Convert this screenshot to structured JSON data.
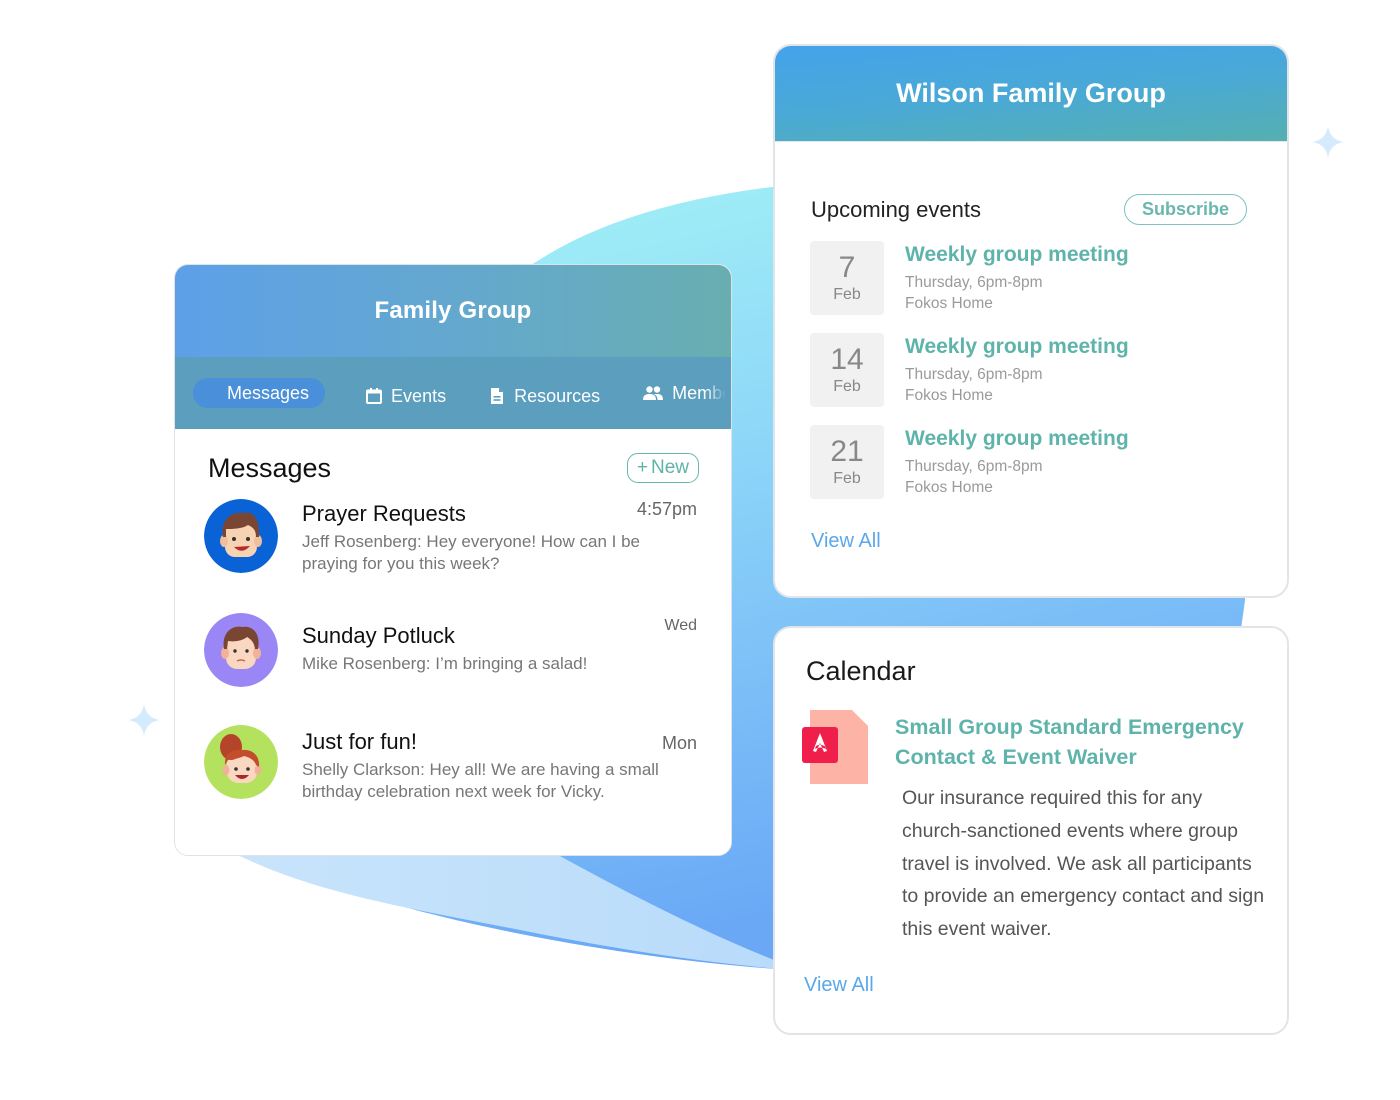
{
  "family_group": {
    "title": "Family Group",
    "tabs": [
      {
        "label": "Messages",
        "icon": "chat",
        "active": true
      },
      {
        "label": "Events",
        "icon": "calendar-icon",
        "active": false
      },
      {
        "label": "Resources",
        "icon": "document-icon",
        "active": false
      },
      {
        "label": "Members",
        "icon": "people-icon",
        "active": false
      }
    ],
    "messages": {
      "heading": "Messages",
      "new_button": "New",
      "new_button_icon": "+",
      "items": [
        {
          "title": "Prayer Requests",
          "time": "4:57pm",
          "preview": "Jeff Rosenberg: Hey everyone! How can I be praying for you this week?",
          "avatar_color": "#0a63d6"
        },
        {
          "title": "Sunday Potluck",
          "time": "Wed",
          "preview": "Mike Rosenberg: I’m bringing a salad!",
          "avatar_color": "#9b86f5"
        },
        {
          "title": "Just for fun!",
          "time": "Mon",
          "preview": "Shelly Clarkson: Hey all! We are having a small birthday celebration next week for Vicky.",
          "avatar_color": "#b4e25e"
        }
      ]
    }
  },
  "wilson_group": {
    "title": "Wilson Family Group",
    "upcoming_events": {
      "heading": "Upcoming events",
      "subscribe_label": "Subscribe",
      "events": [
        {
          "day": "7",
          "month": "Feb",
          "name": "Weekly group meeting",
          "when": "Thursday, 6pm-8pm",
          "where": "Fokos Home"
        },
        {
          "day": "14",
          "month": "Feb",
          "name": "Weekly group meeting",
          "when": "Thursday, 6pm-8pm",
          "where": "Fokos Home"
        },
        {
          "day": "21",
          "month": "Feb",
          "name": "Weekly group meeting",
          "when": "Thursday, 6pm-8pm",
          "where": "Fokos Home"
        }
      ],
      "view_all": "View All"
    }
  },
  "calendar": {
    "heading": "Calendar",
    "document": {
      "type_icon": "pdf-icon",
      "title": "Small Group Standard Emergency Contact & Event Waiver",
      "description": "Our insurance required this for any church-sanctioned events where group travel is involved. We ask all participants to provide an emergency contact and sign this event waiver."
    },
    "view_all": "View All"
  },
  "colors": {
    "accent_teal": "#5eb3aa",
    "link_blue": "#5aa7ea",
    "tab_active": "#4a8fda"
  }
}
